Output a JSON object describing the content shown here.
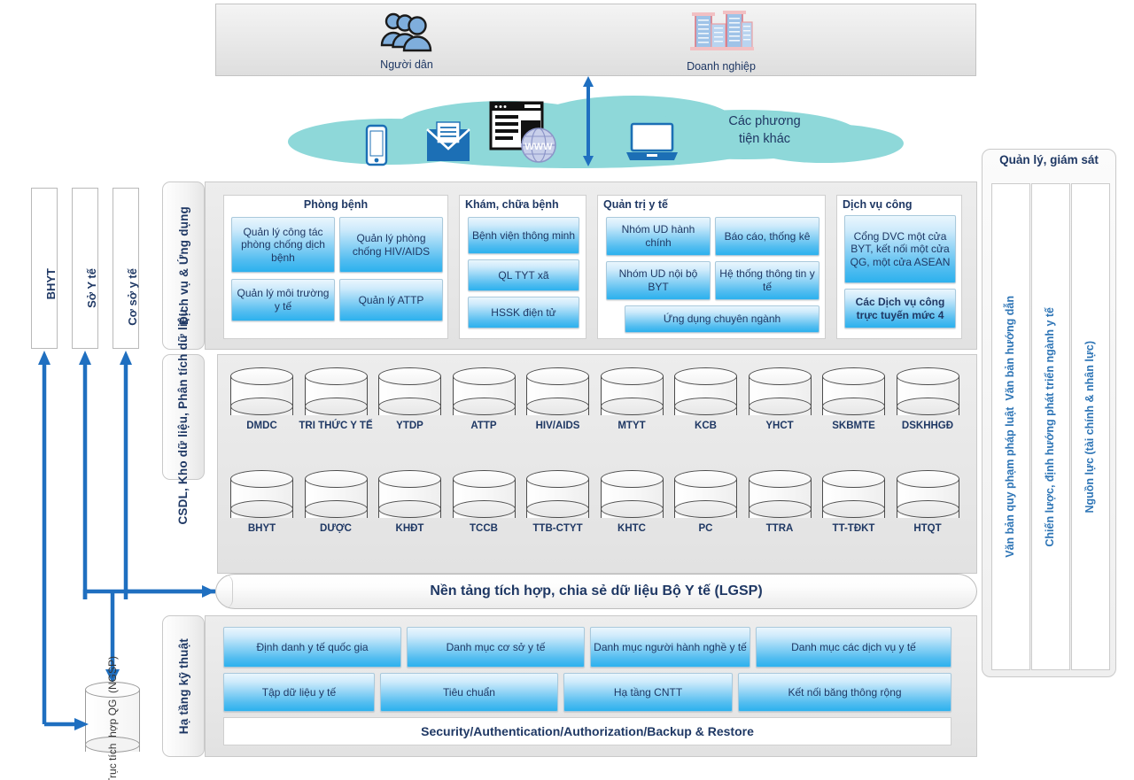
{
  "actors": {
    "people": {
      "label": "Người dân",
      "icon": "people-icon"
    },
    "business": {
      "label": "Doanh nghiệp",
      "icon": "buildings-icon"
    }
  },
  "cloud": {
    "label": "Các phương\ntiện khác",
    "label_line1": "Các phương",
    "label_line2": "tiện khác",
    "icons": [
      "mobile-phone-icon",
      "email-envelope-icon",
      "web-browser-www-icon",
      "laptop-icon"
    ],
    "color": "#8ED8D9"
  },
  "left_column": {
    "boxes": [
      {
        "label": "BHYT"
      },
      {
        "label": "Sở Y tế"
      },
      {
        "label": "Cơ sở y tế"
      }
    ],
    "ngsp": {
      "line1": "Trục tích",
      "line2": "hợp QG",
      "line3": "(NGSP)"
    }
  },
  "layers": {
    "apps": {
      "tab_label": "Dịch vụ & Ứng dụng",
      "groups": [
        {
          "title": "Phòng bệnh",
          "title_align": "center",
          "items": [
            {
              "label": "Quản lý công tác phòng chống dịch bệnh"
            },
            {
              "label": "Quản lý phòng chống HIV/AIDS"
            },
            {
              "label": "Quản lý môi trường y tế"
            },
            {
              "label": "Quản lý ATTP"
            }
          ]
        },
        {
          "title": "Khám, chữa bệnh",
          "title_align": "left",
          "items": [
            {
              "label": "Bệnh viện thông minh"
            },
            {
              "label": "QL TYT xã"
            },
            {
              "label": "HSSK điện tử"
            }
          ]
        },
        {
          "title": "Quản trị y tế",
          "title_align": "left",
          "items": [
            {
              "label": "Nhóm UD hành chính"
            },
            {
              "label": "Báo cáo, thống kê"
            },
            {
              "label": "Nhóm UD nội bộ BYT"
            },
            {
              "label": "Hệ thống thông tin y tế"
            },
            {
              "label": "Ứng dụng chuyên ngành"
            }
          ]
        },
        {
          "title": "Dịch vụ công",
          "title_align": "left",
          "items": [
            {
              "label": "Cổng DVC một cửa BYT, kết nối một cửa QG, một cửa ASEAN"
            },
            {
              "label": "Các Dịch vụ công trực tuyến mức 4",
              "bold": true
            }
          ]
        }
      ]
    },
    "data": {
      "tab_label": "CSDL, Kho dữ liệu, Phân tích dữ liệu",
      "row1": [
        "DMDC",
        "TRI THỨC Y TẾ",
        "YTDP",
        "ATTP",
        "HIV/AIDS",
        "MTYT",
        "KCB",
        "YHCT",
        "SKBMTE",
        "DSKHHGĐ"
      ],
      "row2": [
        "BHYT",
        "DƯỢC",
        "KHĐT",
        "TCCB",
        "TTB-CTYT",
        "KHTC",
        "PC",
        "TTRA",
        "TT-TĐKT",
        "HTQT"
      ]
    },
    "lgsp": {
      "label": "Nền tảng tích hợp, chia sẻ dữ liệu Bộ Y tế (LGSP)"
    },
    "infra": {
      "tab_label": "Hạ tầng kỹ thuật",
      "row1": [
        "Định danh y tế quốc gia",
        "Danh mục cơ sở y tế",
        "Danh mục người hành nghề y tế",
        "Danh mục các dịch vụ y tế"
      ],
      "row2": [
        "Tập dữ liệu y tế",
        "Tiêu chuẩn",
        "Hạ tầng CNTT",
        "Kết nối băng thông rộng"
      ],
      "footer": "Security/Authentication/Authorization/Backup & Restore"
    }
  },
  "manage_panel": {
    "title": "Quản lý, giám sát",
    "columns": [
      {
        "label": "Văn bản quy phạm pháp luật\nVăn bản hướng dẫn",
        "line1": "Văn bản quy phạm pháp luật",
        "line2": "Văn bản hướng dẫn"
      },
      {
        "label": "Chiến lược, định hướng phát triển ngành y tế"
      },
      {
        "label": "Nguồn lực (tài chính & nhân lực)"
      }
    ]
  },
  "colors": {
    "accent_blue": "#1F6FC0",
    "box_blue": "#2CB1EE",
    "text_navy": "#1F3864",
    "cloud_teal": "#8ED8D9",
    "panel_gray": "#E6E6E6"
  }
}
